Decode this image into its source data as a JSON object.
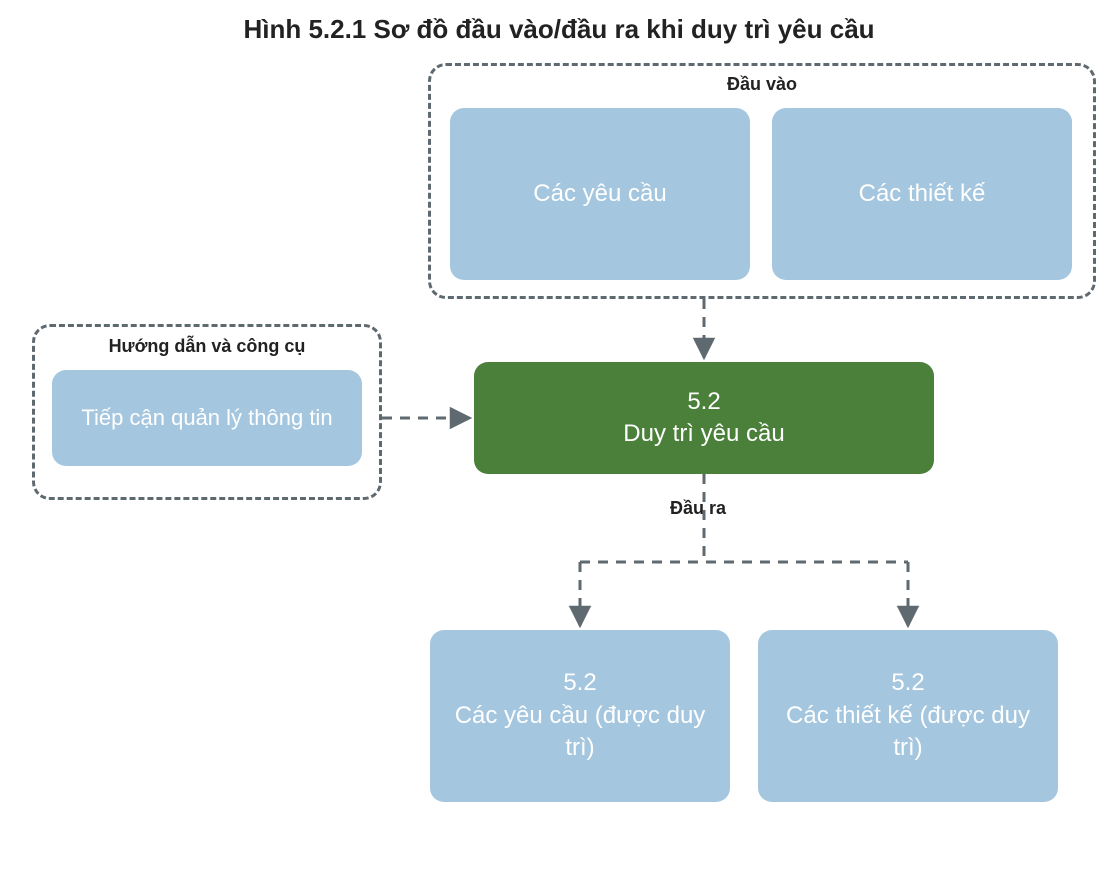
{
  "title": "Hình 5.2.1 Sơ đồ đầu vào/đầu ra khi duy trì yêu cầu",
  "groups": {
    "inputs_label": "Đầu vào",
    "guides_label": "Hướng dẫn và công cụ",
    "outputs_label": "Đầu ra"
  },
  "boxes": {
    "input_requirements": "Các yêu cầu",
    "input_designs": "Các thiết kế",
    "guide_info_mgmt": "Tiếp cận quản lý thông tin",
    "center_process": "5.2\nDuy trì yêu cầu",
    "output_requirements": "5.2\nCác yêu cầu (được duy trì)",
    "output_designs": "5.2\nCác thiết kế (được duy trì)"
  },
  "colors": {
    "blue": "#a4c6de",
    "green": "#4b803a",
    "dash": "#5f6a70"
  }
}
